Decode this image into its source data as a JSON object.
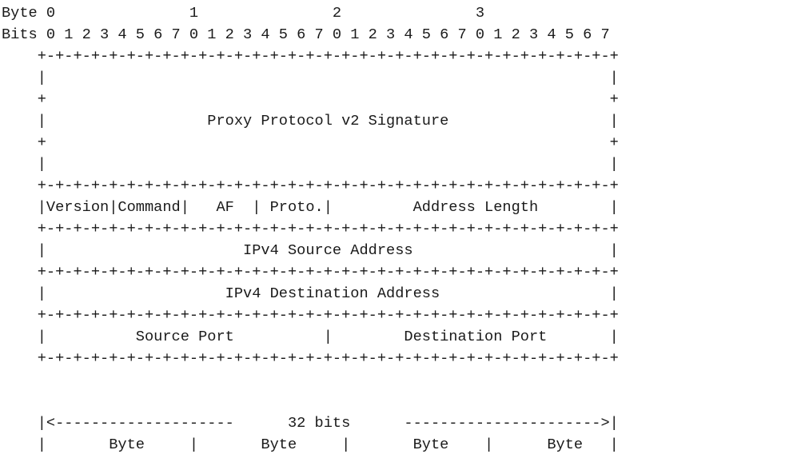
{
  "diagram": {
    "lines": [
      "Byte 0               1               2               3",
      "Bits 0 1 2 3 4 5 6 7 0 1 2 3 4 5 6 7 0 1 2 3 4 5 6 7 0 1 2 3 4 5 6 7",
      "    +-+-+-+-+-+-+-+-+-+-+-+-+-+-+-+-+-+-+-+-+-+-+-+-+-+-+-+-+-+-+-+-+",
      "    |                                                               |",
      "    +                                                               +",
      "    |                  Proxy Protocol v2 Signature                  |",
      "    +                                                               +",
      "    |                                                               |",
      "    +-+-+-+-+-+-+-+-+-+-+-+-+-+-+-+-+-+-+-+-+-+-+-+-+-+-+-+-+-+-+-+-+",
      "    |Version|Command|   AF  | Proto.|         Address Length        |",
      "    +-+-+-+-+-+-+-+-+-+-+-+-+-+-+-+-+-+-+-+-+-+-+-+-+-+-+-+-+-+-+-+-+",
      "    |                      IPv4 Source Address                      |",
      "    +-+-+-+-+-+-+-+-+-+-+-+-+-+-+-+-+-+-+-+-+-+-+-+-+-+-+-+-+-+-+-+-+",
      "    |                    IPv4 Destination Address                   |",
      "    +-+-+-+-+-+-+-+-+-+-+-+-+-+-+-+-+-+-+-+-+-+-+-+-+-+-+-+-+-+-+-+-+",
      "    |          Source Port          |        Destination Port       |",
      "    +-+-+-+-+-+-+-+-+-+-+-+-+-+-+-+-+-+-+-+-+-+-+-+-+-+-+-+-+-+-+-+-+",
      "",
      "",
      "    |<--------------------      32 bits      ---------------------->|",
      "    |       Byte     |       Byte     |       Byte    |      Byte   |"
    ]
  }
}
